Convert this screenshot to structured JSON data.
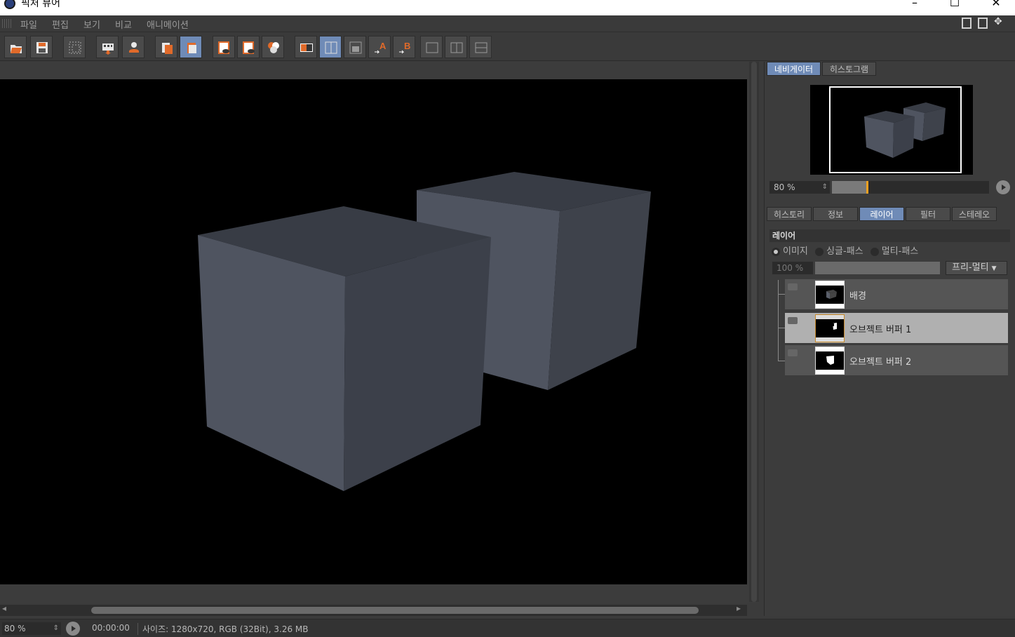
{
  "window": {
    "title": "픽처 뷰어",
    "controls": [
      "–",
      "☐",
      "✕"
    ]
  },
  "menu": [
    "파일",
    "편집",
    "보기",
    "비교",
    "애니메이션"
  ],
  "toolbar": {
    "buttons": [
      "open-icon",
      "save-icon",
      "grid-icon",
      "export-icon",
      "upload-icon",
      "copy-icon",
      "paste-icon",
      "view-a-icon",
      "view-b-icon",
      "compare-icon",
      "ab-swap-icon",
      "ab-split-icon",
      "ab-overlay-icon",
      "set-a-icon",
      "set-b-icon",
      "ab-1-icon",
      "ab-2-icon",
      "ab-3-icon"
    ]
  },
  "navigator": {
    "tabs": [
      "네비게이터",
      "히스토그램"
    ],
    "zoom": "80 %",
    "zoom_fraction": 0.22
  },
  "panel": {
    "tabs": [
      "히스토리",
      "정보",
      "레이어",
      "필터",
      "스테레오"
    ],
    "section_title": "레이어",
    "modes": [
      "이미지",
      "싱글-패스",
      "멀티-패스"
    ],
    "selected_mode": "이미지",
    "opacity": "100 %",
    "blend": "프리-멀티",
    "layers": [
      {
        "name": "배경",
        "selected": false
      },
      {
        "name": "오브젝트 버퍼 1",
        "selected": true
      },
      {
        "name": "오브젝트 버퍼 2",
        "selected": false
      }
    ]
  },
  "status": {
    "zoom": "80 %",
    "time": "00:00:00",
    "info": "사이즈: 1280x720, RGB (32Bit), 3.26 MB"
  },
  "colors": {
    "accent": "#6f8bb7",
    "cube_light": "#4f5460",
    "cube_dark": "#3c404a",
    "cube_top": "#383c45"
  }
}
